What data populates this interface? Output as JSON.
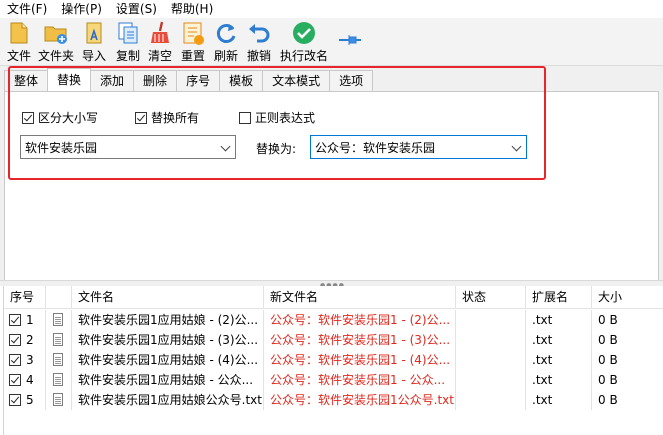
{
  "menu": [
    "文件(F)",
    "操作(P)",
    "设置(S)",
    "帮助(H)"
  ],
  "toolbar": {
    "file": "文件",
    "folder": "文件夹",
    "import": "导入",
    "copy": "复制",
    "clear": "清空",
    "reset": "重置",
    "refresh": "刷新",
    "undo": "撤销",
    "execute": "执行改名"
  },
  "tabs": [
    "整体",
    "替换",
    "添加",
    "删除",
    "序号",
    "模板",
    "文本模式",
    "选项"
  ],
  "replace": {
    "case_sensitive": "区分大小写",
    "replace_all": "替换所有",
    "regex": "正则表达式",
    "find_value": "软件安装乐园",
    "replace_label": "替换为:",
    "replace_value": "公众号：软件安装乐园",
    "states": {
      "case_sensitive": true,
      "replace_all": true,
      "regex": false
    }
  },
  "grid": {
    "headers": [
      "序号",
      "文件名",
      "新文件名",
      "状态",
      "扩展名",
      "大小"
    ],
    "rows": [
      {
        "no": "1",
        "name": "软件安装乐园1应用姑娘 - (2)公...",
        "new": "公众号：软件安装乐园1 - (2)公...",
        "status": "",
        "ext": ".txt",
        "size": "0 B"
      },
      {
        "no": "2",
        "name": "软件安装乐园1应用姑娘 - (3)公...",
        "new": "公众号：软件安装乐园1 - (3)公...",
        "status": "",
        "ext": ".txt",
        "size": "0 B"
      },
      {
        "no": "3",
        "name": "软件安装乐园1应用姑娘 - (4)公...",
        "new": "公众号：软件安装乐园1 - (4)公...",
        "status": "",
        "ext": ".txt",
        "size": "0 B"
      },
      {
        "no": "4",
        "name": "软件安装乐园1应用姑娘 - 公众...",
        "new": "公众号：软件安装乐园1 - 公众...",
        "status": "",
        "ext": ".txt",
        "size": "0 B"
      },
      {
        "no": "5",
        "name": "软件安装乐园1应用姑娘公众号.txt",
        "new": "公众号：软件安装乐园1公众号.txt",
        "status": "",
        "ext": ".txt",
        "size": "0 B"
      }
    ]
  },
  "colors": {
    "highlight_border": "#e8252b",
    "new_name_text": "#e0271d",
    "accent": "#0078d7"
  }
}
